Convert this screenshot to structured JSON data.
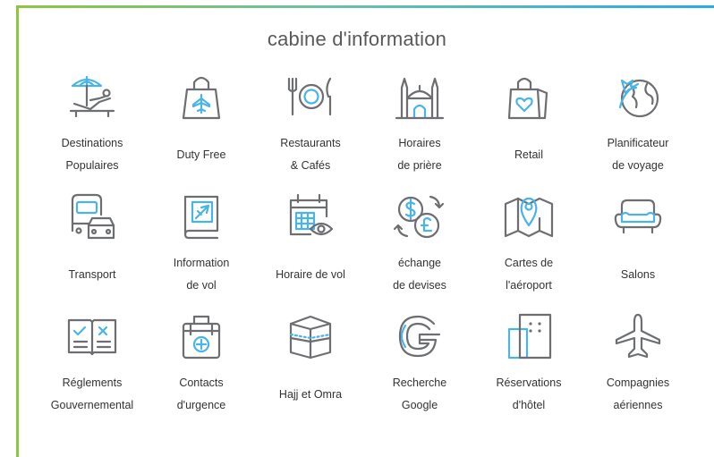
{
  "page": {
    "title": "cabine d'information"
  },
  "colors": {
    "accent_blue": "#4ab4e8",
    "icon_gray": "#6d6e71",
    "frame_green": "#8dc63f"
  },
  "tiles": [
    {
      "line1": "Destinations",
      "line2": "Populaires",
      "icon": "beach-umbrella-icon"
    },
    {
      "line1": "Duty Free",
      "line2": "",
      "icon": "shopping-bag-plane-icon"
    },
    {
      "line1": "Restaurants",
      "line2": "& Cafés",
      "icon": "fork-plate-knife-icon"
    },
    {
      "line1": "Horaires",
      "line2": "de prière",
      "icon": "mosque-icon"
    },
    {
      "line1": "Retail",
      "line2": "",
      "icon": "shopping-bag-heart-icon"
    },
    {
      "line1": "Planificateur",
      "line2": "de voyage",
      "icon": "globe-plane-icon"
    },
    {
      "line1": "Transport",
      "line2": "",
      "icon": "bus-car-icon"
    },
    {
      "line1": "Information",
      "line2": "de vol",
      "icon": "flight-book-icon"
    },
    {
      "line1": "Horaire de vol",
      "line2": "",
      "icon": "calendar-eye-icon"
    },
    {
      "line1": "échange",
      "line2": "de devises",
      "icon": "currency-exchange-icon"
    },
    {
      "line1": "Cartes de",
      "line2": "l'aéroport",
      "icon": "map-pin-icon"
    },
    {
      "line1": "Salons",
      "line2": "",
      "icon": "sofa-icon"
    },
    {
      "line1": "Réglements",
      "line2": "Gouvernemental",
      "icon": "open-book-checklist-icon"
    },
    {
      "line1": "Contacts",
      "line2": "d'urgence",
      "icon": "first-aid-kit-icon"
    },
    {
      "line1": "Hajj et Omra",
      "line2": "",
      "icon": "kaaba-icon"
    },
    {
      "line1": "Recherche",
      "line2": "Google",
      "icon": "google-icon"
    },
    {
      "line1": "Réservations",
      "line2": "d'hôtel",
      "icon": "hotel-building-icon"
    },
    {
      "line1": "Compagnies",
      "line2": "aériennes",
      "icon": "airplane-icon"
    }
  ]
}
